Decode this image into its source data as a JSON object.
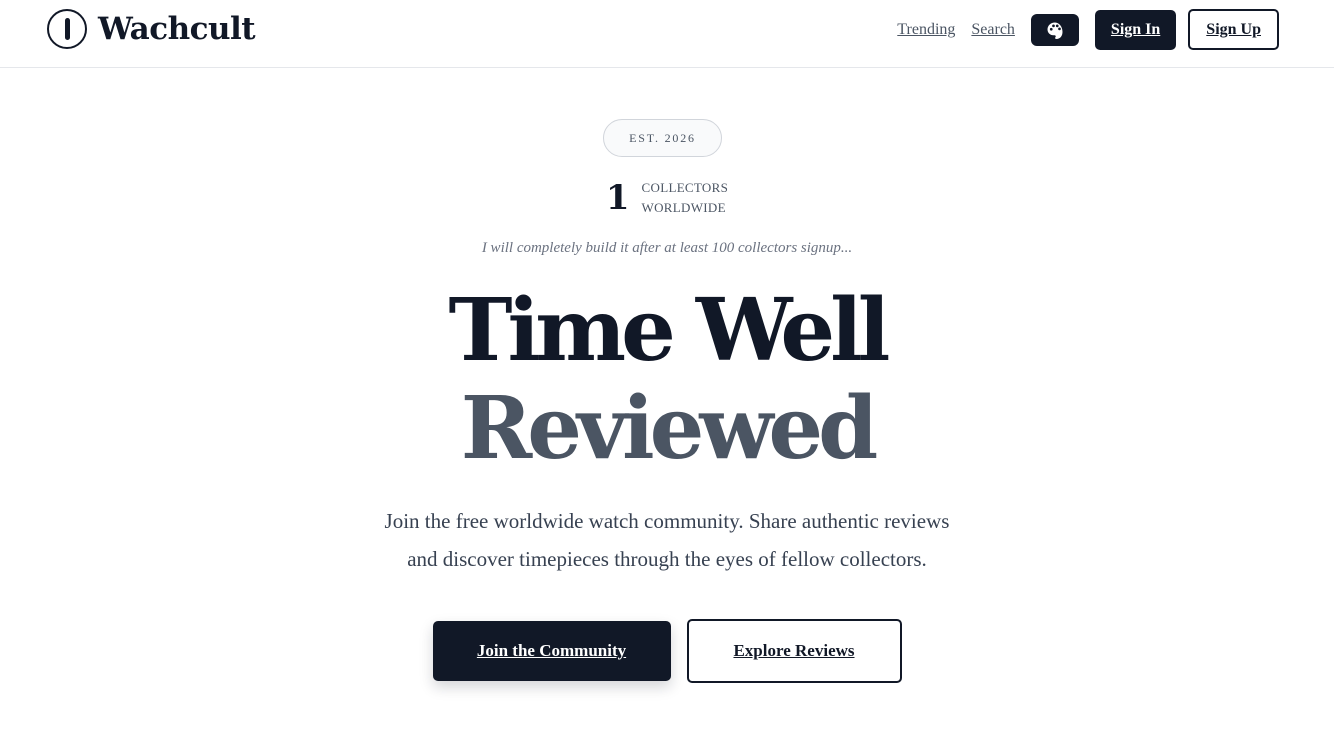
{
  "header": {
    "brand_name": "Wachcult",
    "nav": {
      "trending": "Trending",
      "search": "Search",
      "theme_icon": "palette-icon",
      "sign_in": "Sign In",
      "sign_up": "Sign Up"
    }
  },
  "hero": {
    "badge": "EST. 2026",
    "collector_count": "1",
    "collector_label_line1": "COLLECTORS",
    "collector_label_line2": "WORLDWIDE",
    "note": "I will completely build it after at least 100 collectors signup...",
    "headline_line1": "Time Well",
    "headline_line2": "Reviewed",
    "subtext_line1": "Join the free worldwide watch community. Share authentic reviews",
    "subtext_line2": "and discover timepieces through the eyes of fellow collectors.",
    "primary_cta": "Join the Community",
    "secondary_cta": "Explore Reviews"
  },
  "colors": {
    "primary": "#111827",
    "secondary_text": "#4b5563",
    "border": "#e5e7eb",
    "background": "#ffffff"
  }
}
